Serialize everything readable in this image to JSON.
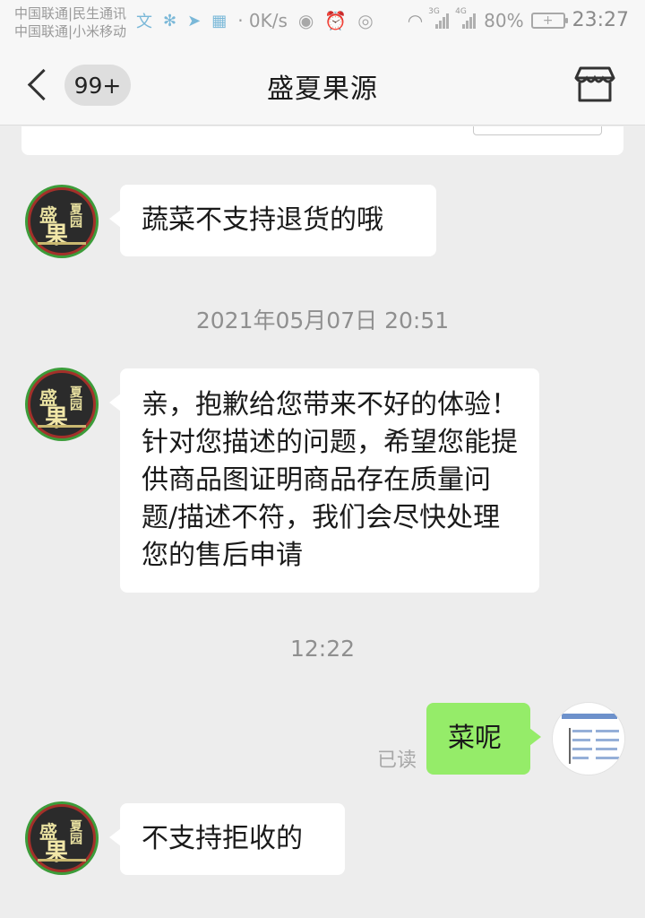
{
  "status_bar": {
    "carrier_line1": "中国联通|民生通讯",
    "carrier_line2": "中国联通|小米移动",
    "net_speed": "0K/s",
    "signal1_tag": "3G",
    "signal2_tag": "4G",
    "battery_pct": "80%",
    "time": "23:27"
  },
  "nav": {
    "unread_badge": "99+",
    "title": "盛夏果源"
  },
  "avatar_logo": {
    "glyph_top": "盛",
    "glyph_main": "果",
    "glyph_side": "夏园"
  },
  "messages": [
    {
      "id": "m1",
      "sender": "shop",
      "text": "蔬菜不支持退货的哦"
    },
    {
      "id": "ts1",
      "type": "timestamp",
      "text": "2021年05月07日 20:51"
    },
    {
      "id": "m2",
      "sender": "shop",
      "text": "亲，抱歉给您带来不好的体验！针对您描述的问题，希望您能提供商品图证明商品存在质量问题/描述不符，我们会尽快处理您的售后申请"
    },
    {
      "id": "ts2",
      "type": "timestamp",
      "text": "12:22"
    },
    {
      "id": "m3",
      "sender": "me",
      "text": "菜呢",
      "read_status": "已读"
    },
    {
      "id": "m4",
      "sender": "shop",
      "text": "不支持拒收的"
    }
  ],
  "colors": {
    "incoming_bubble": "#ffffff",
    "outgoing_bubble": "#95ec69",
    "background": "#ededed"
  }
}
